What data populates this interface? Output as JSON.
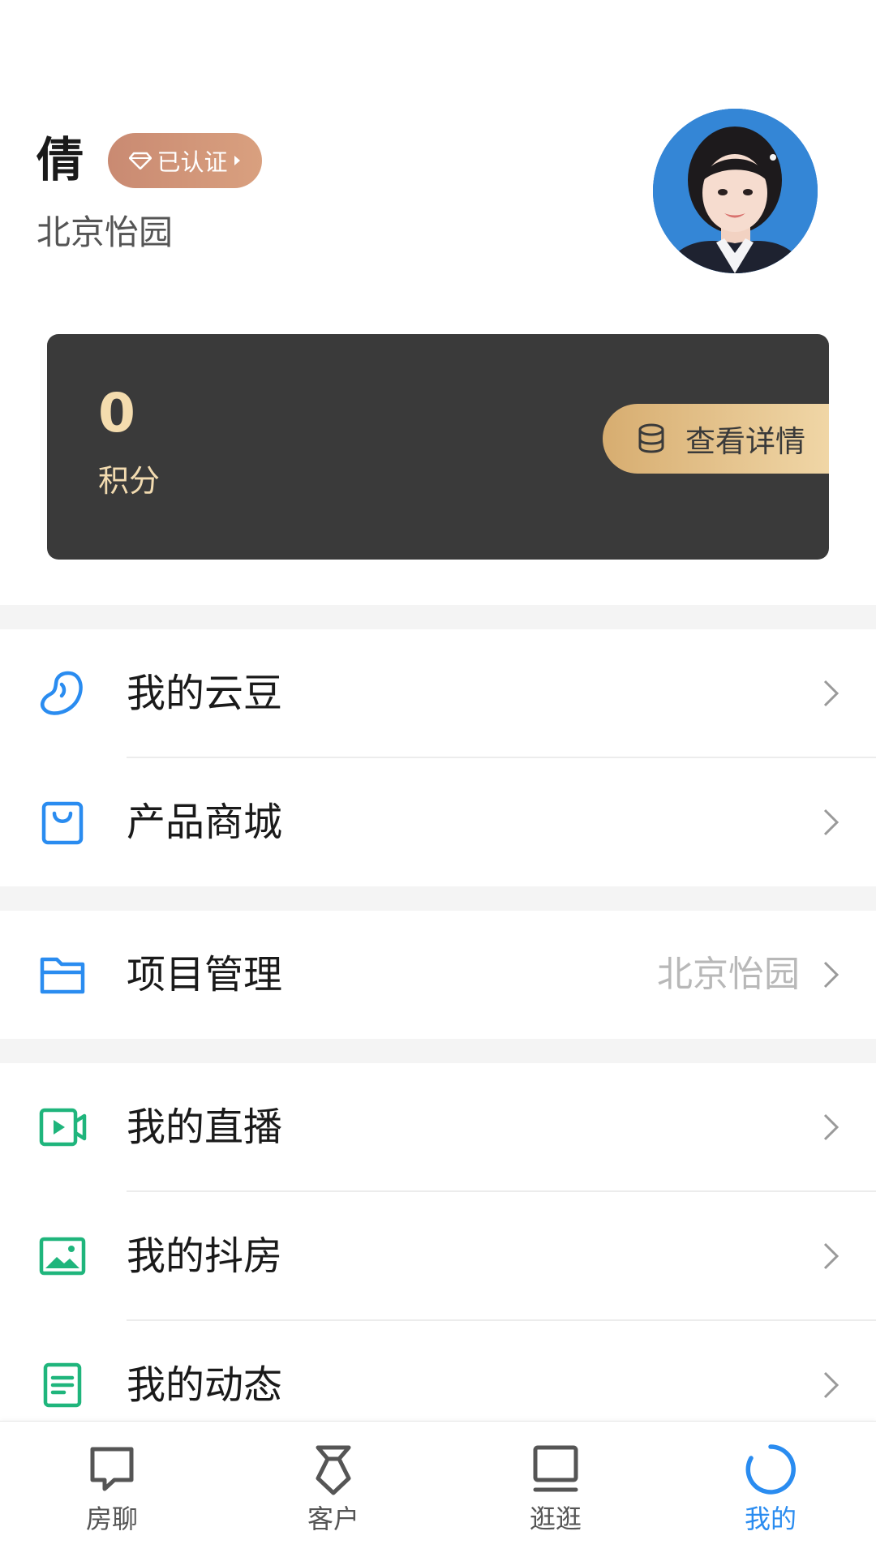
{
  "profile": {
    "name": "倩",
    "verified_label": "已认证",
    "project": "北京怡园"
  },
  "points_card": {
    "value": "0",
    "label": "积分",
    "details_button": "查看详情"
  },
  "menu": [
    {
      "label": "我的云豆",
      "icon": "bean-icon"
    },
    {
      "label": "产品商城",
      "icon": "shopping-bag-icon"
    },
    {
      "label": "项目管理",
      "icon": "folder-icon",
      "value": "北京怡园"
    },
    {
      "label": "我的直播",
      "icon": "live-video-icon"
    },
    {
      "label": "我的抖房",
      "icon": "image-icon"
    },
    {
      "label": "我的动态",
      "icon": "document-icon"
    }
  ],
  "bottom_nav": [
    {
      "label": "房聊",
      "icon": "chat-icon"
    },
    {
      "label": "客户",
      "icon": "tie-icon"
    },
    {
      "label": "逛逛",
      "icon": "laptop-icon"
    },
    {
      "label": "我的",
      "icon": "profile-ring-icon",
      "active": true
    }
  ],
  "colors": {
    "accent_blue": "#2a8cf0",
    "accent_green": "#1fb57c",
    "badge": "#d09478",
    "card_bg": "#3a3a3a",
    "gold": "#e6c48c"
  }
}
